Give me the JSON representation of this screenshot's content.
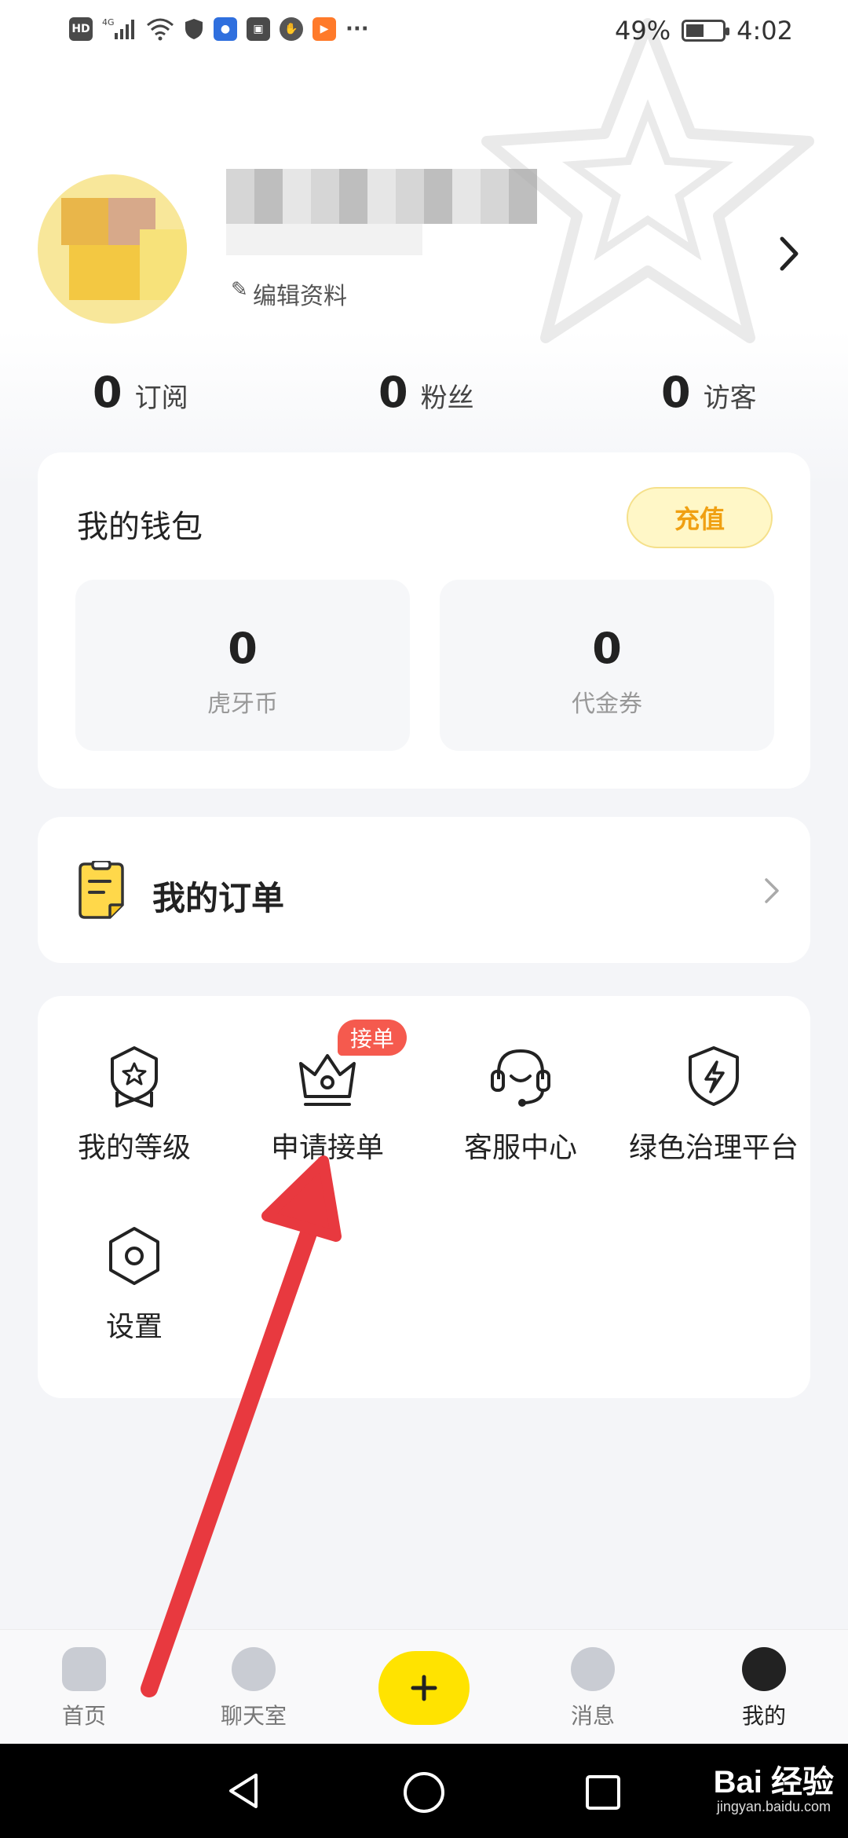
{
  "status_bar": {
    "left_icons": [
      "HD",
      "4G",
      "signal-icon",
      "wifi-icon",
      "shield-icon",
      "bulb-icon",
      "huawei-icon",
      "hand-icon",
      "play-icon",
      "more-icon"
    ],
    "hd": "HD",
    "battery": "49%",
    "battery_level": 0.49,
    "time": "4:02",
    "more": "···"
  },
  "profile": {
    "edit_label": "编辑资料"
  },
  "stats": [
    {
      "value": "0",
      "label": "订阅"
    },
    {
      "value": "0",
      "label": "粉丝"
    },
    {
      "value": "0",
      "label": "访客"
    }
  ],
  "wallet": {
    "title": "我的钱包",
    "recharge_label": "充值",
    "items": [
      {
        "value": "0",
        "label": "虎牙币"
      },
      {
        "value": "0",
        "label": "代金券"
      }
    ]
  },
  "orders": {
    "title": "我的订单"
  },
  "tools": {
    "items": [
      {
        "label": "我的等级",
        "icon": "level-badge-icon"
      },
      {
        "label": "申请接单",
        "icon": "crown-icon",
        "badge": "接单"
      },
      {
        "label": "客服中心",
        "icon": "headset-icon"
      },
      {
        "label": "绿色治理平台",
        "icon": "lightning-shield-icon"
      },
      {
        "label": "设置",
        "icon": "settings-icon"
      }
    ]
  },
  "bottom_nav": {
    "items": [
      {
        "label": "首页",
        "icon": "home-icon"
      },
      {
        "label": "聊天室",
        "icon": "chatroom-icon"
      },
      {
        "label": "",
        "icon": "plus-icon"
      },
      {
        "label": "消息",
        "icon": "message-icon"
      },
      {
        "label": "我的",
        "icon": "profile-icon"
      }
    ],
    "active": "我的"
  },
  "colors": {
    "accent_yellow": "#ffe300",
    "badge_red": "#f55a4e",
    "recharge_text": "#f0a012",
    "annotation_arrow": "#e8393f"
  },
  "watermark": {
    "brand": "Bai 经验",
    "url": "jingyan.baidu.com"
  }
}
